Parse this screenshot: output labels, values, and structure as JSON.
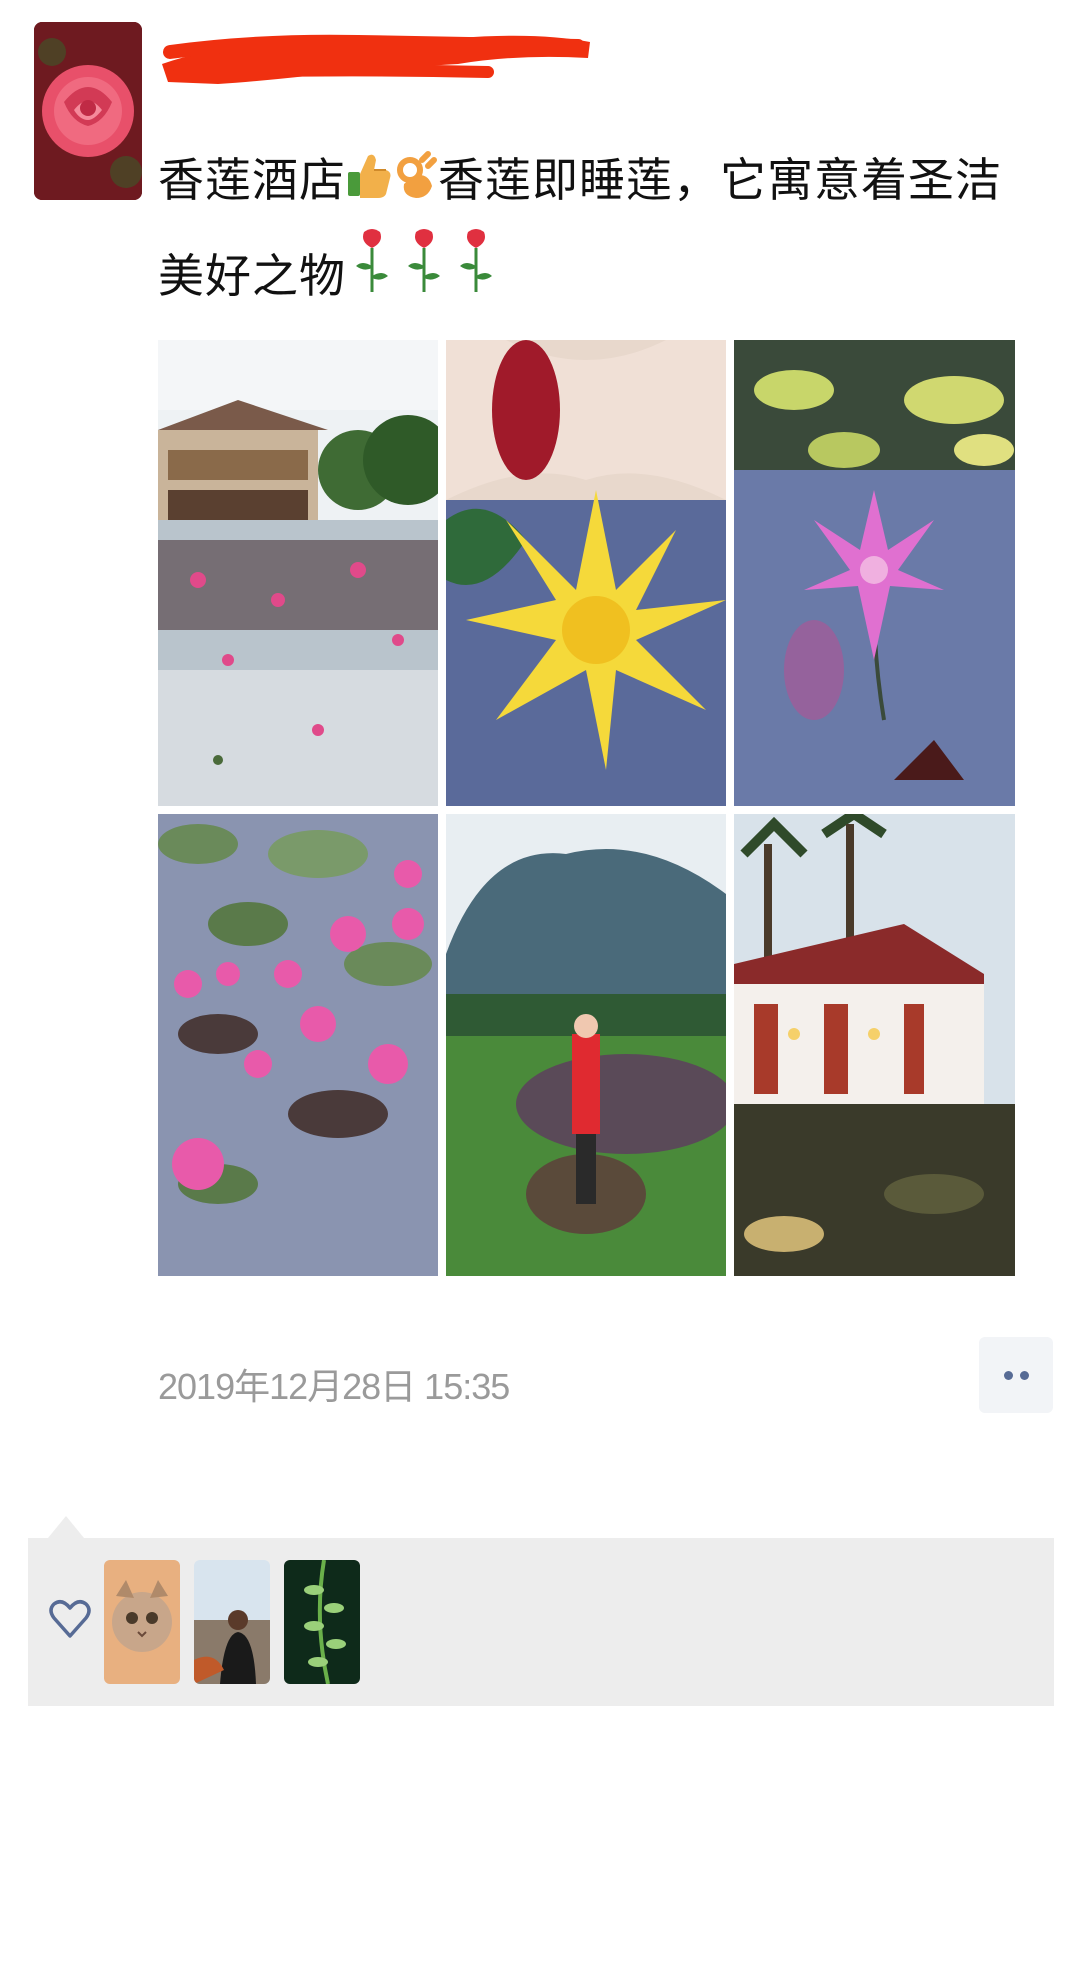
{
  "post": {
    "author_name_visible": "",
    "text_part1": "香莲酒店",
    "text_part2": "香莲即睡莲，它寓意着圣洁美好之物",
    "emojis": [
      "thumbs-up-icon",
      "ok-hand-icon",
      "rose-icon",
      "rose-icon",
      "rose-icon"
    ],
    "timestamp": "2019年12月28日 15:35"
  },
  "photos": [
    {
      "name": "photo-hotel-lotus-pond"
    },
    {
      "name": "photo-yellow-water-lily"
    },
    {
      "name": "photo-pink-water-lily"
    },
    {
      "name": "photo-pink-lotus-field"
    },
    {
      "name": "photo-woman-by-pond"
    },
    {
      "name": "photo-hotel-building-evening"
    }
  ],
  "likes": {
    "icon": "heart-outline-icon",
    "likers": [
      {
        "name": "liker-avatar-cat"
      },
      {
        "name": "liker-avatar-person"
      },
      {
        "name": "liker-avatar-plant"
      }
    ]
  },
  "colors": {
    "link_blue": "#576b95",
    "timestamp_gray": "#9a9a9a",
    "panel_bg": "#ededed",
    "redaction_red": "#f03010"
  }
}
